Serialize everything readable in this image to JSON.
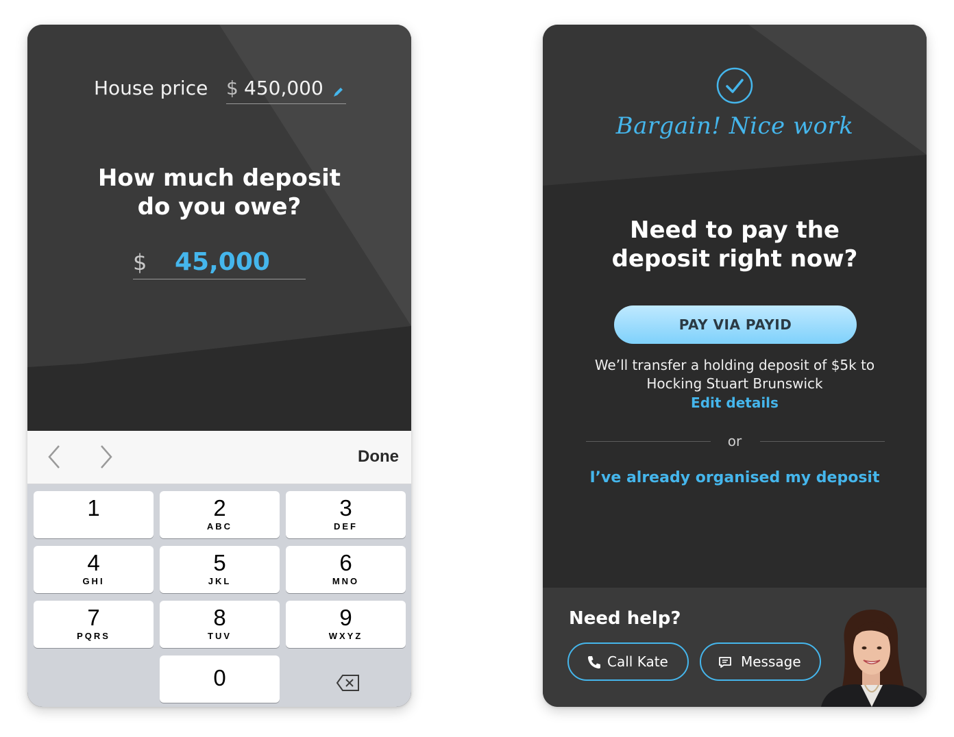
{
  "left_screen": {
    "house_price": {
      "label": "House price",
      "currency": "$",
      "value": "450,000"
    },
    "question_line1": "How much deposit",
    "question_line2": "do you owe?",
    "deposit": {
      "currency": "$",
      "value": "45,000"
    },
    "toolbar": {
      "done_label": "Done"
    },
    "keypad": [
      {
        "num": "1",
        "letters": ""
      },
      {
        "num": "2",
        "letters": "ABC"
      },
      {
        "num": "3",
        "letters": "DEF"
      },
      {
        "num": "4",
        "letters": "GHI"
      },
      {
        "num": "5",
        "letters": "JKL"
      },
      {
        "num": "6",
        "letters": "MNO"
      },
      {
        "num": "7",
        "letters": "PQRS"
      },
      {
        "num": "8",
        "letters": "TUV"
      },
      {
        "num": "9",
        "letters": "WXYZ"
      },
      {
        "num": "0",
        "letters": ""
      }
    ]
  },
  "right_screen": {
    "success_title": "Bargain! Nice work",
    "question_line1": "Need to pay the",
    "question_line2": "deposit right now?",
    "pay_button": "PAY VIA PAYID",
    "transfer_line1": "We’ll transfer a holding deposit of $5k to",
    "transfer_line2": "Hocking Stuart Brunswick",
    "edit_link": "Edit details",
    "or": "or",
    "already_link": "I’ve already organised my deposit",
    "help": {
      "title": "Need help?",
      "call_label": "Call Kate",
      "message_label": "Message"
    }
  },
  "colors": {
    "accent": "#45b6ec",
    "screen_bg": "#2b2b2b",
    "keypad_bg": "#d0d3d9"
  }
}
